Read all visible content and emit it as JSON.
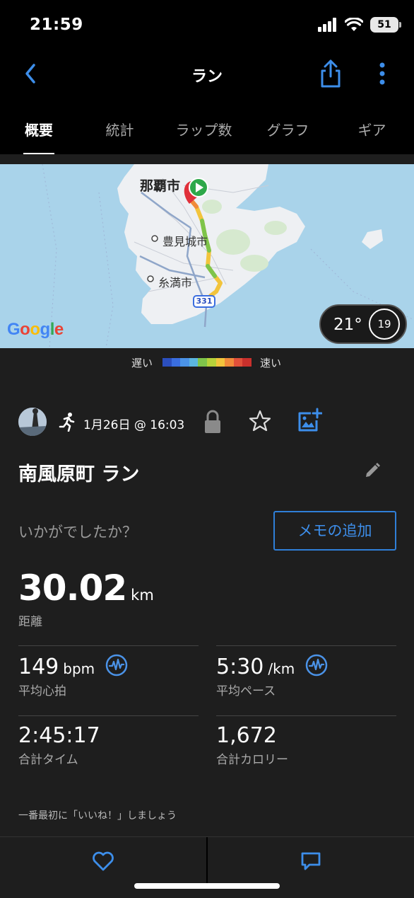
{
  "status_bar": {
    "time": "21:59",
    "battery": "51"
  },
  "nav": {
    "title": "ラン",
    "back_icon": "chevron-left-icon",
    "share_icon": "share-icon",
    "more_icon": "more-vertical-icon"
  },
  "tabs": [
    "概要",
    "統計",
    "ラップ数",
    "グラフ",
    "ギア"
  ],
  "map": {
    "labels": {
      "naha": "那覇市",
      "tomigusuku": "豊見城市",
      "itoman": "糸満市",
      "route": "331"
    },
    "google": "Google",
    "weather": {
      "temp": "21°",
      "wind": "19"
    }
  },
  "legend": {
    "slow": "遅い",
    "fast": "速い",
    "colors": [
      "#2b4fbf",
      "#3a6ee0",
      "#4b93e8",
      "#5bb6e0",
      "#7ec44a",
      "#b7d23a",
      "#f2c43c",
      "#f08a3a",
      "#e0503a",
      "#c9302c"
    ]
  },
  "activity": {
    "date": "1月26日 @ 16:03",
    "title": "南風原町 ラン",
    "feeling_prompt": "いかがでしたか？",
    "memo_button": "メモの追加"
  },
  "stats": {
    "distance": {
      "value": "30.02",
      "unit": "km",
      "label": "距離"
    },
    "heart_rate": {
      "value": "149",
      "unit": "bpm",
      "label": "平均心拍"
    },
    "pace": {
      "value": "5:30",
      "unit": "/km",
      "label": "平均ペース"
    },
    "time": {
      "value": "2:45:17",
      "label": "合計タイム"
    },
    "calories": {
      "value": "1,672",
      "label": "合計カロリー"
    }
  },
  "like_prompt": "一番最初に「いいね！」しましょう",
  "colors": {
    "accent": "#3d8eea",
    "background": "#1e1e1e"
  }
}
